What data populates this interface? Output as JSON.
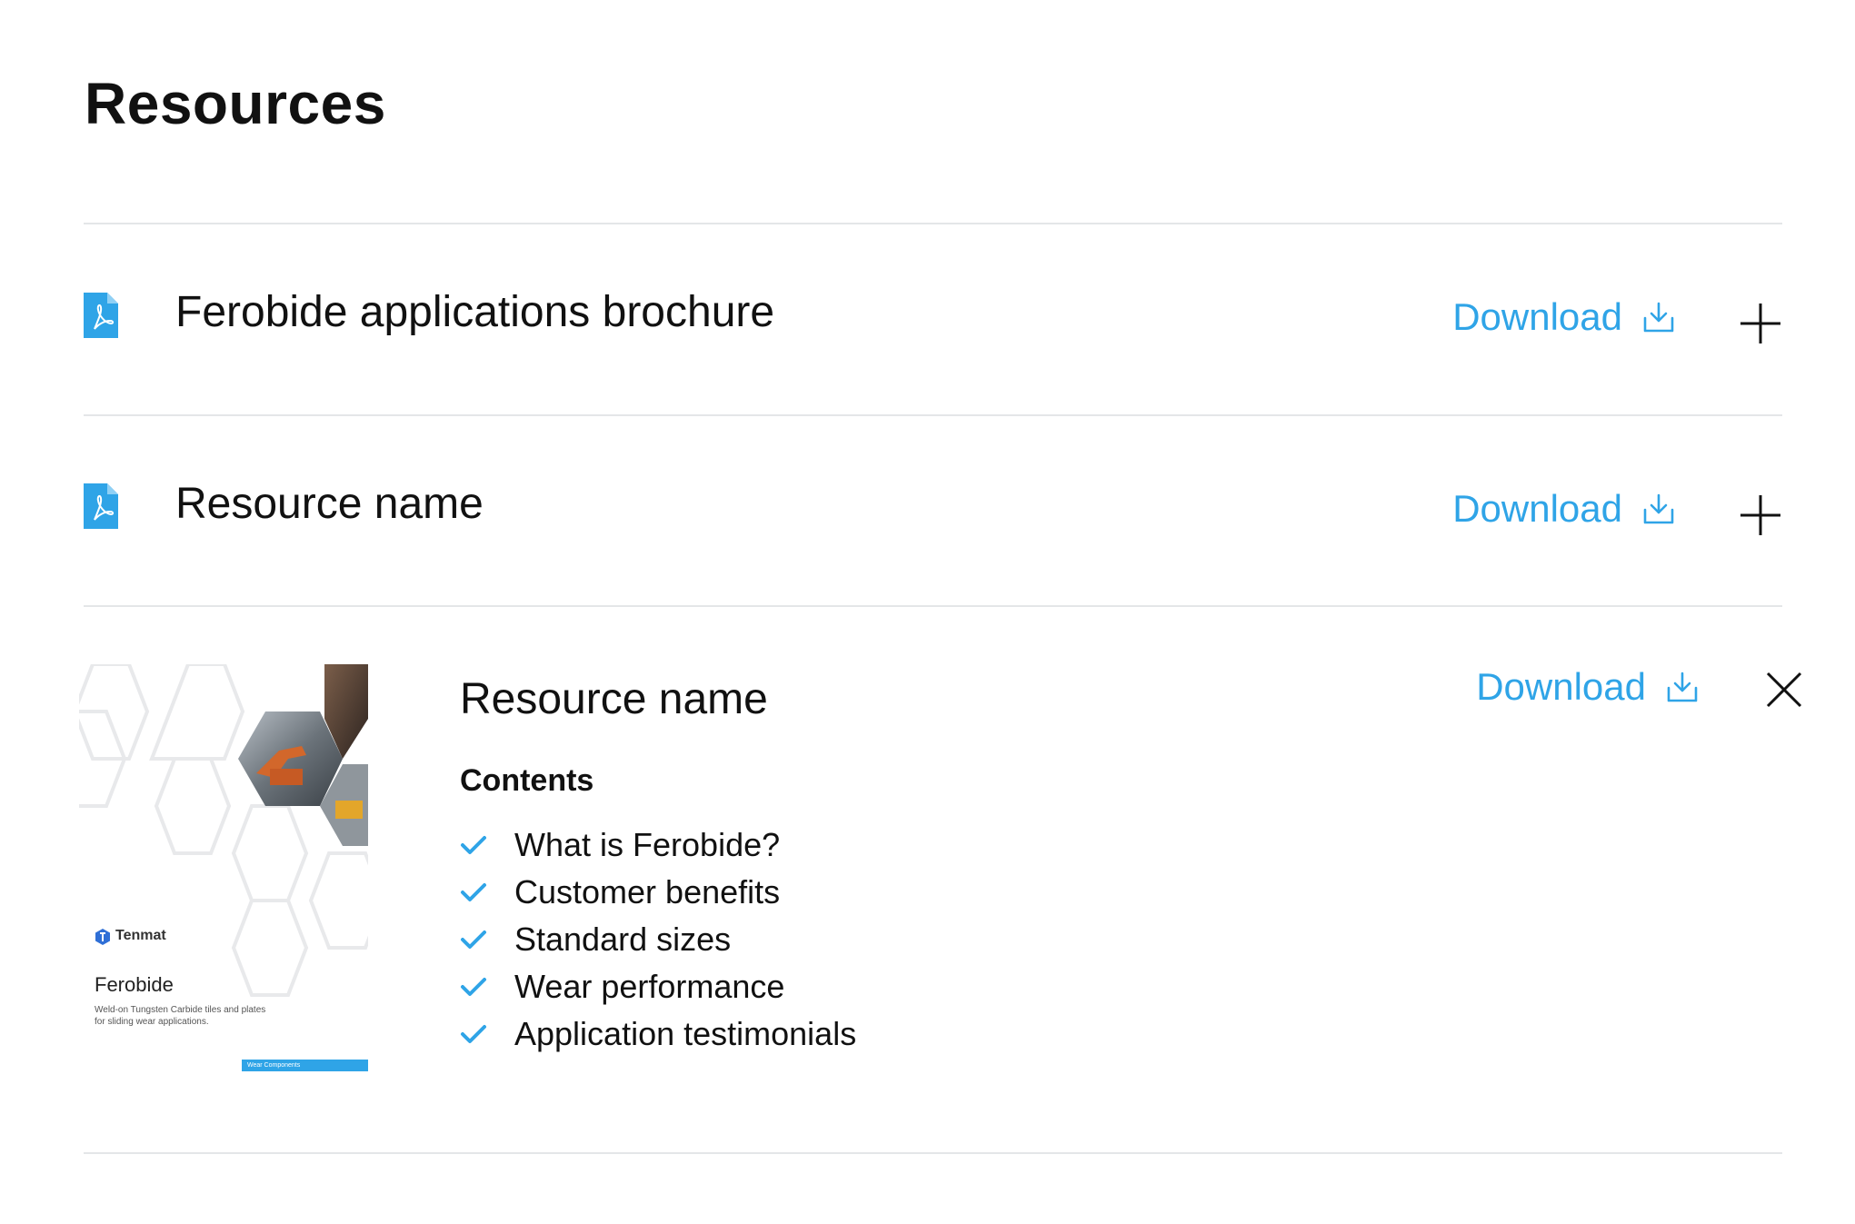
{
  "page": {
    "title": "Resources"
  },
  "colors": {
    "accent": "#2fa4e7",
    "divider": "#e4e6e8",
    "text": "#111111"
  },
  "download_label": "Download",
  "resources": [
    {
      "name": "Ferobide applications brochure",
      "icon": "pdf-file-icon",
      "expanded": false,
      "toggle_icon": "plus-icon"
    },
    {
      "name": "Resource name",
      "icon": "pdf-file-icon",
      "expanded": false,
      "toggle_icon": "plus-icon"
    },
    {
      "name": "Resource name",
      "expanded": true,
      "toggle_icon": "close-icon",
      "thumbnail": {
        "brand": "Tenmat",
        "title": "Ferobide",
        "subtitle_line1": "Weld-on Tungsten Carbide tiles and plates",
        "subtitle_line2": "for sliding wear applications.",
        "footer_tag": "Wear Components"
      },
      "contents_heading": "Contents",
      "contents": [
        "What is Ferobide?",
        "Customer benefits",
        "Standard sizes",
        "Wear performance",
        "Application testimonials"
      ]
    }
  ]
}
